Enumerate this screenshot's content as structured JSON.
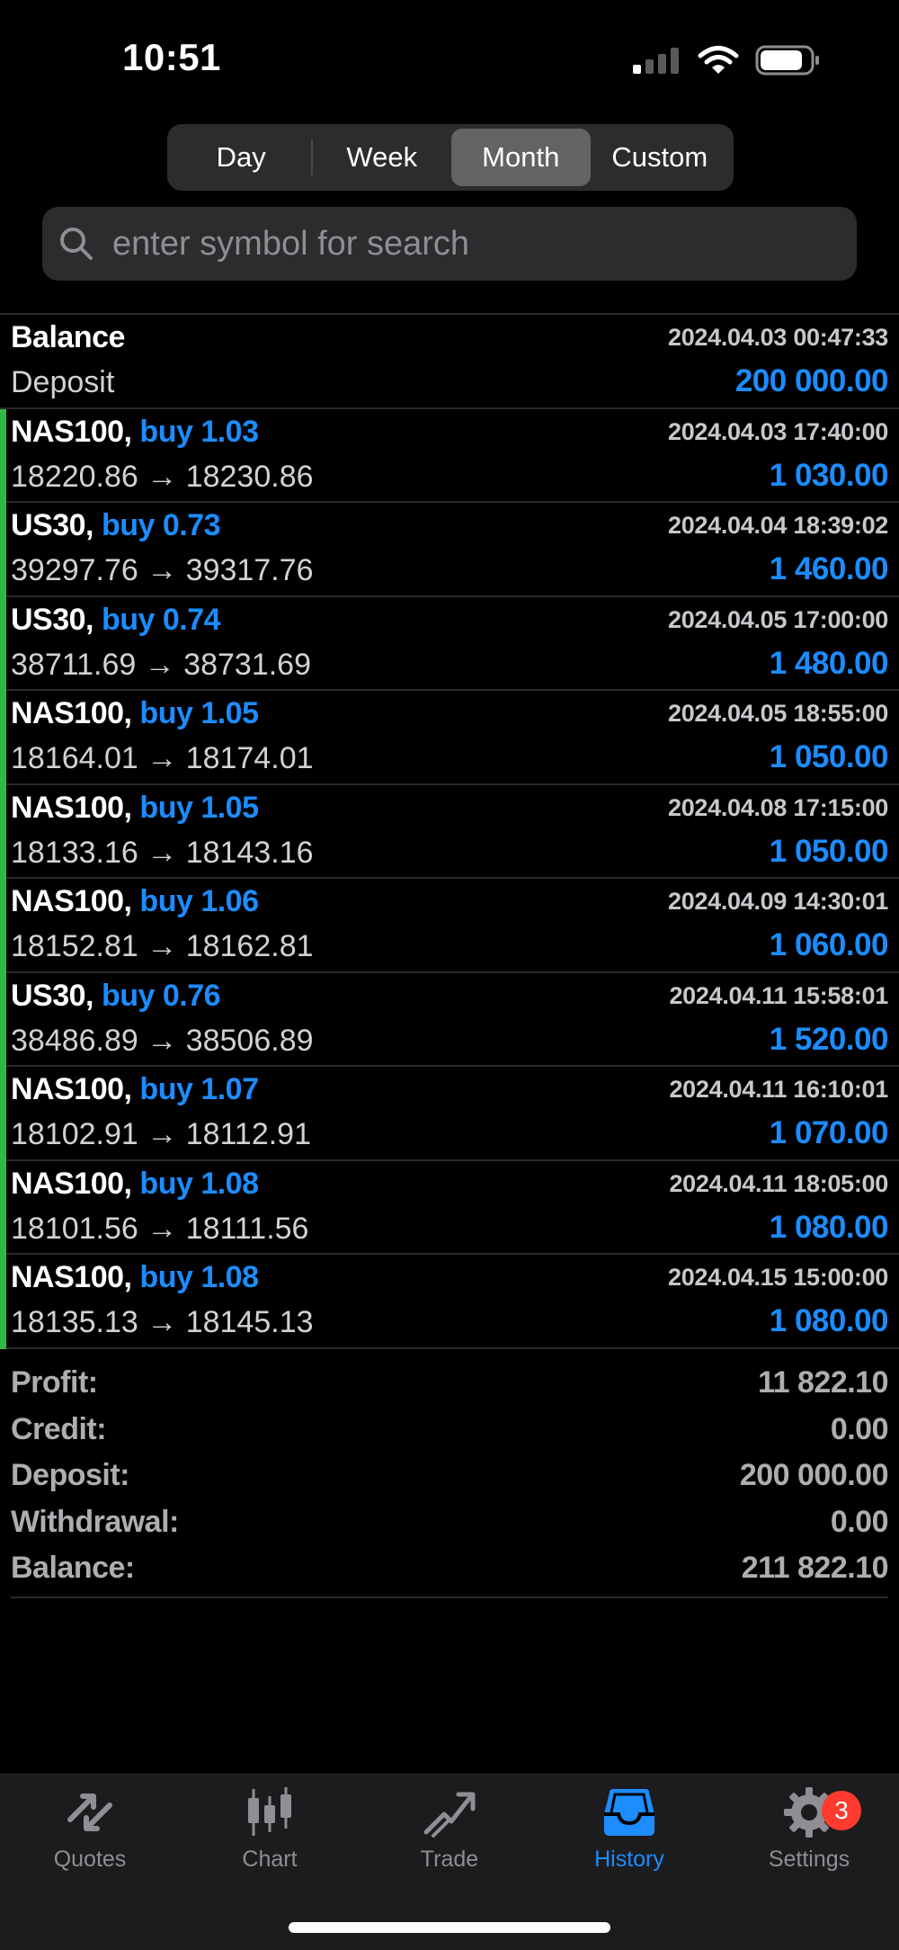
{
  "status_bar": {
    "time": "10:51"
  },
  "period_tabs": [
    {
      "label": "Day",
      "active": false
    },
    {
      "label": "Week",
      "active": false
    },
    {
      "label": "Month",
      "active": true
    },
    {
      "label": "Custom",
      "active": false
    }
  ],
  "search": {
    "placeholder": "enter symbol for search"
  },
  "balance_entry": {
    "title": "Balance",
    "time": "2024.04.03 00:47:33",
    "type": "Deposit",
    "amount": "200 000.00"
  },
  "deals": [
    {
      "symbol": "NAS100,",
      "side": "buy 1.03",
      "time": "2024.04.03 17:40:00",
      "prices": "18220.86 → 18230.86",
      "profit": "1 030.00"
    },
    {
      "symbol": "US30,",
      "side": "buy 0.73",
      "time": "2024.04.04 18:39:02",
      "prices": "39297.76 → 39317.76",
      "profit": "1 460.00"
    },
    {
      "symbol": "US30,",
      "side": "buy 0.74",
      "time": "2024.04.05 17:00:00",
      "prices": "38711.69 → 38731.69",
      "profit": "1 480.00"
    },
    {
      "symbol": "NAS100,",
      "side": "buy 1.05",
      "time": "2024.04.05 18:55:00",
      "prices": "18164.01 → 18174.01",
      "profit": "1 050.00"
    },
    {
      "symbol": "NAS100,",
      "side": "buy 1.05",
      "time": "2024.04.08 17:15:00",
      "prices": "18133.16 → 18143.16",
      "profit": "1 050.00"
    },
    {
      "symbol": "NAS100,",
      "side": "buy 1.06",
      "time": "2024.04.09 14:30:01",
      "prices": "18152.81 → 18162.81",
      "profit": "1 060.00"
    },
    {
      "symbol": "US30,",
      "side": "buy 0.76",
      "time": "2024.04.11 15:58:01",
      "prices": "38486.89 → 38506.89",
      "profit": "1 520.00"
    },
    {
      "symbol": "NAS100,",
      "side": "buy 1.07",
      "time": "2024.04.11 16:10:01",
      "prices": "18102.91 → 18112.91",
      "profit": "1 070.00"
    },
    {
      "symbol": "NAS100,",
      "side": "buy 1.08",
      "time": "2024.04.11 18:05:00",
      "prices": "18101.56 → 18111.56",
      "profit": "1 080.00"
    },
    {
      "symbol": "NAS100,",
      "side": "buy 1.08",
      "time": "2024.04.15 15:00:00",
      "prices": "18135.13 → 18145.13",
      "profit": "1 080.00"
    }
  ],
  "summary": [
    {
      "label": "Profit:",
      "value": "11 822.10"
    },
    {
      "label": "Credit:",
      "value": "0.00"
    },
    {
      "label": "Deposit:",
      "value": "200 000.00"
    },
    {
      "label": "Withdrawal:",
      "value": "0.00"
    },
    {
      "label": "Balance:",
      "value": "211 822.10"
    }
  ],
  "tabbar": [
    {
      "label": "Quotes",
      "icon": "quotes-icon",
      "active": false
    },
    {
      "label": "Chart",
      "icon": "chart-icon",
      "active": false
    },
    {
      "label": "Trade",
      "icon": "trade-icon",
      "active": false
    },
    {
      "label": "History",
      "icon": "history-icon",
      "active": true
    },
    {
      "label": "Settings",
      "icon": "gear-icon",
      "active": false,
      "badge": "3"
    }
  ],
  "colors": {
    "accent": "#1c8cff",
    "profit_bar": "#2dbb3f",
    "badge": "#ff3b30"
  }
}
